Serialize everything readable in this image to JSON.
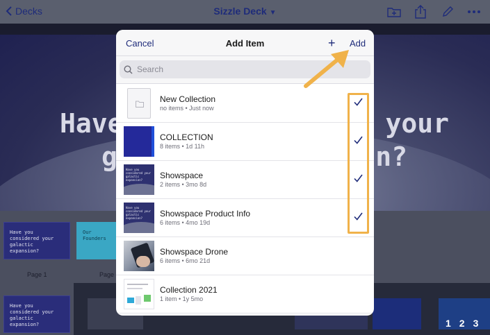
{
  "app": {
    "back_label": "Decks",
    "title": "Sizzle Deck",
    "tool_icons": [
      "new-folder-icon",
      "share-icon",
      "edit-pencil-icon",
      "more-icon"
    ]
  },
  "background": {
    "hero_text_line1_left": "Have",
    "hero_text_line1_right": "your",
    "hero_text_line2_left": "g",
    "hero_text_line2_right": "n?",
    "thumb1_text": "Have you considered your galactic expansion?",
    "thumb2_text": "Our Founders",
    "page_label_1": "Page 1",
    "page_label_2": "Page"
  },
  "modal": {
    "cancel_label": "Cancel",
    "title": "Add Item",
    "add_label": "Add",
    "search_placeholder": "Search",
    "items": [
      {
        "name": "New Collection",
        "meta": "no items • Just now",
        "checked": true,
        "thumb": "folder"
      },
      {
        "name": "COLLECTION",
        "meta": "8 items • 1d 11h",
        "checked": true,
        "thumb": "collection"
      },
      {
        "name": "Showspace",
        "meta": "2 items • 3mo 8d",
        "checked": true,
        "thumb": "deck"
      },
      {
        "name": "Showspace Product Info",
        "meta": "6 items • 4mo 19d",
        "checked": true,
        "thumb": "deck"
      },
      {
        "name": "Showspace Drone",
        "meta": "6 items • 6mo 21d",
        "checked": false,
        "thumb": "drone"
      },
      {
        "name": "Collection 2021",
        "meta": "1 item • 1y 5mo",
        "checked": false,
        "thumb": "doc"
      }
    ]
  },
  "deck_thumb_text": "Have you considered your galactic expansion?",
  "colors": {
    "accent": "#1e2b7a",
    "annotation": "#f0b24a"
  }
}
